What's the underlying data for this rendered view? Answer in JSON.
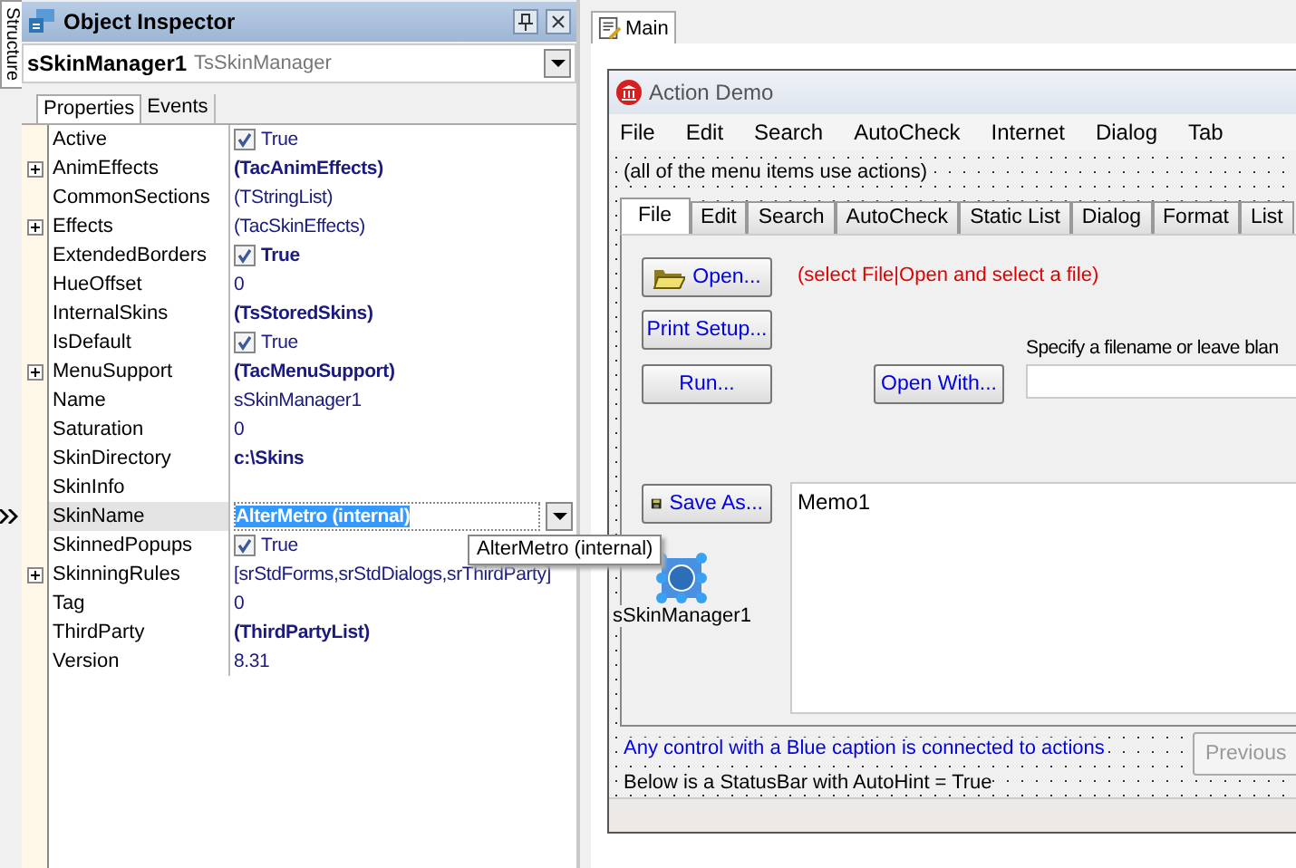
{
  "side_tab": {
    "label": "Structure"
  },
  "inspector": {
    "title": "Object Inspector",
    "object_name": "sSkinManager1",
    "object_type": "TsSkinManager",
    "tabs": [
      {
        "label": "Properties",
        "selected": true
      },
      {
        "label": "Events",
        "selected": false
      }
    ],
    "properties": [
      {
        "name": "Active",
        "value": "True",
        "kind": "check",
        "checked": true,
        "bold": false,
        "expandable": false,
        "selected": false
      },
      {
        "name": "AnimEffects",
        "value": "(TacAnimEffects)",
        "kind": "text",
        "bold": true,
        "expandable": true,
        "selected": false
      },
      {
        "name": "CommonSections",
        "value": "(TStringList)",
        "kind": "text",
        "bold": false,
        "expandable": false,
        "selected": false
      },
      {
        "name": "Effects",
        "value": "(TacSkinEffects)",
        "kind": "text",
        "bold": false,
        "expandable": true,
        "selected": false
      },
      {
        "name": "ExtendedBorders",
        "value": "True",
        "kind": "check",
        "checked": true,
        "bold": true,
        "expandable": false,
        "selected": false
      },
      {
        "name": "HueOffset",
        "value": "0",
        "kind": "text",
        "bold": false,
        "expandable": false,
        "selected": false
      },
      {
        "name": "InternalSkins",
        "value": "(TsStoredSkins)",
        "kind": "text",
        "bold": true,
        "expandable": false,
        "selected": false
      },
      {
        "name": "IsDefault",
        "value": "True",
        "kind": "check",
        "checked": true,
        "bold": false,
        "expandable": false,
        "selected": false
      },
      {
        "name": "MenuSupport",
        "value": "(TacMenuSupport)",
        "kind": "text",
        "bold": true,
        "expandable": true,
        "selected": false
      },
      {
        "name": "Name",
        "value": "sSkinManager1",
        "kind": "text",
        "bold": false,
        "expandable": false,
        "selected": false
      },
      {
        "name": "Saturation",
        "value": "0",
        "kind": "text",
        "bold": false,
        "expandable": false,
        "selected": false
      },
      {
        "name": "SkinDirectory",
        "value": "c:\\Skins",
        "kind": "text",
        "bold": true,
        "expandable": false,
        "selected": false
      },
      {
        "name": "SkinInfo",
        "kind": "text",
        "expandable": false,
        "selected": false
      },
      {
        "name": "SkinName",
        "value": "AlterMetro (internal)",
        "kind": "combo",
        "bold": true,
        "expandable": false,
        "selected": true
      },
      {
        "name": "SkinnedPopups",
        "value": "True",
        "kind": "check",
        "checked": true,
        "bold": false,
        "expandable": false,
        "selected": false
      },
      {
        "name": "SkinningRules",
        "value": "[srStdForms,srStdDialogs,srThirdParty]",
        "kind": "text",
        "bold": false,
        "expandable": true,
        "selected": false
      },
      {
        "name": "Tag",
        "value": "0",
        "kind": "text",
        "bold": false,
        "expandable": false,
        "selected": false
      },
      {
        "name": "ThirdParty",
        "value": "(ThirdPartyList)",
        "kind": "text",
        "bold": true,
        "expandable": false,
        "selected": false
      },
      {
        "name": "Version",
        "value": "8.31",
        "kind": "text",
        "bold": false,
        "expandable": false,
        "selected": false
      }
    ],
    "tooltip": "AlterMetro (internal)"
  },
  "designer": {
    "tab": "Main",
    "form": {
      "title": "Action Demo",
      "menu": [
        "File",
        "Edit",
        "Search",
        "AutoCheck",
        "Internet",
        "Dialog",
        "Tab"
      ],
      "note": "(all of the menu items use actions)",
      "page_tabs": [
        {
          "label": "File",
          "selected": true
        },
        {
          "label": "Edit",
          "selected": false
        },
        {
          "label": "Search",
          "selected": false
        },
        {
          "label": "AutoCheck",
          "selected": false
        },
        {
          "label": "Static List",
          "selected": false
        },
        {
          "label": "Dialog",
          "selected": false
        },
        {
          "label": "Format",
          "selected": false
        },
        {
          "label": "List",
          "selected": false
        }
      ],
      "buttons": [
        {
          "label": "Open..."
        },
        {
          "label": "Print Setup..."
        },
        {
          "label": "Run..."
        },
        {
          "label": "Open With..."
        },
        {
          "label": "Save As..."
        }
      ],
      "hint": "(select File|Open and select a file)",
      "field_label": "Specify a filename or leave blan",
      "memo": "Memo1",
      "component": "sSkinManager1",
      "caption_note": "Any control with a Blue caption is connected to actions",
      "status_note": "Below is a StatusBar with AutoHint = True",
      "previous_button": {
        "label": "Previous",
        "disabled": true
      }
    }
  }
}
